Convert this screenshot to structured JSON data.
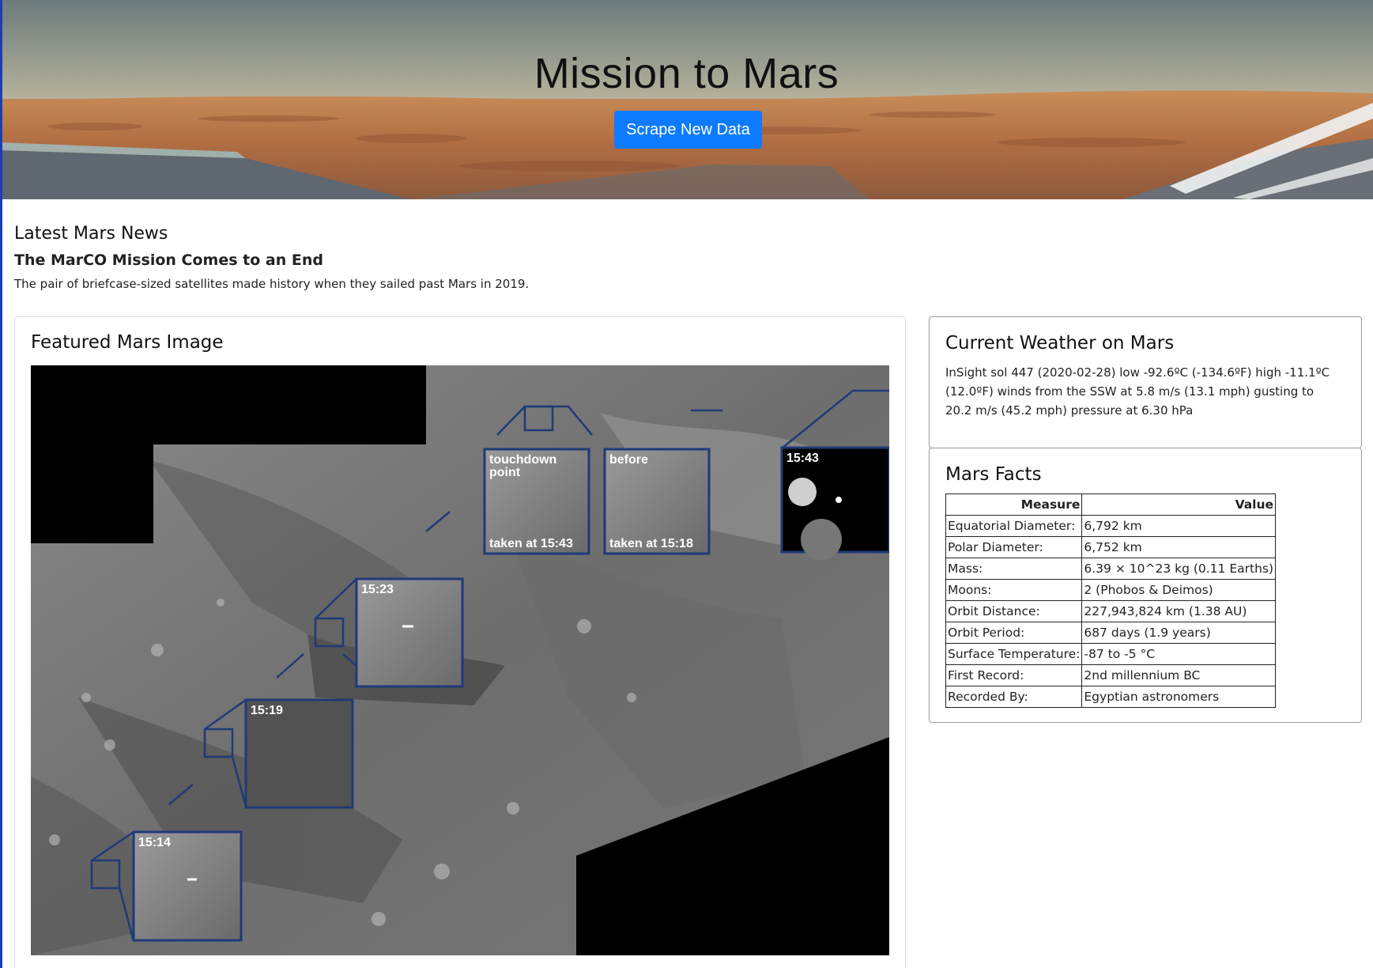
{
  "hero": {
    "title": "Mission to Mars",
    "scrape_button": "Scrape New Data"
  },
  "news": {
    "heading": "Latest Mars News",
    "title": "The MarCO Mission Comes to an End",
    "teaser": "The pair of briefcase-sized satellites made history when they sailed past Mars in 2019."
  },
  "featured_image": {
    "heading": "Featured Mars Image",
    "labels": {
      "touchdown": [
        "touchdown",
        "point"
      ],
      "before": "before",
      "taken_1543": "taken at 15:43",
      "taken_1518": "taken at 15:18",
      "t1543": "15:43",
      "t1523": "15:23",
      "t1519": "15:19",
      "t1514": "15:14"
    }
  },
  "weather": {
    "heading": "Current Weather on Mars",
    "text": "InSight sol 447 (2020-02-28) low -92.6ºC (-134.6ºF) high -11.1ºC (12.0ºF) winds from the SSW at 5.8 m/s (13.1 mph) gusting to 20.2 m/s (45.2 mph) pressure at 6.30 hPa"
  },
  "facts": {
    "heading": "Mars Facts",
    "columns": [
      "Measure",
      "Value"
    ],
    "rows": [
      [
        "Equatorial Diameter:",
        "6,792 km"
      ],
      [
        "Polar Diameter:",
        "6,752 km"
      ],
      [
        "Mass:",
        "6.39 × 10^23 kg (0.11 Earths)"
      ],
      [
        "Moons:",
        "2 (Phobos & Deimos)"
      ],
      [
        "Orbit Distance:",
        "227,943,824 km (1.38 AU)"
      ],
      [
        "Orbit Period:",
        "687 days (1.9 years)"
      ],
      [
        "Surface Temperature:",
        "-87 to -5 °C"
      ],
      [
        "First Record:",
        "2nd millennium BC"
      ],
      [
        "Recorded By:",
        "Egyptian astronomers"
      ]
    ]
  },
  "colors": {
    "button": "#0d7bff",
    "inset_frame": "#1f3a78",
    "left_accent": "#1a3fb0"
  }
}
